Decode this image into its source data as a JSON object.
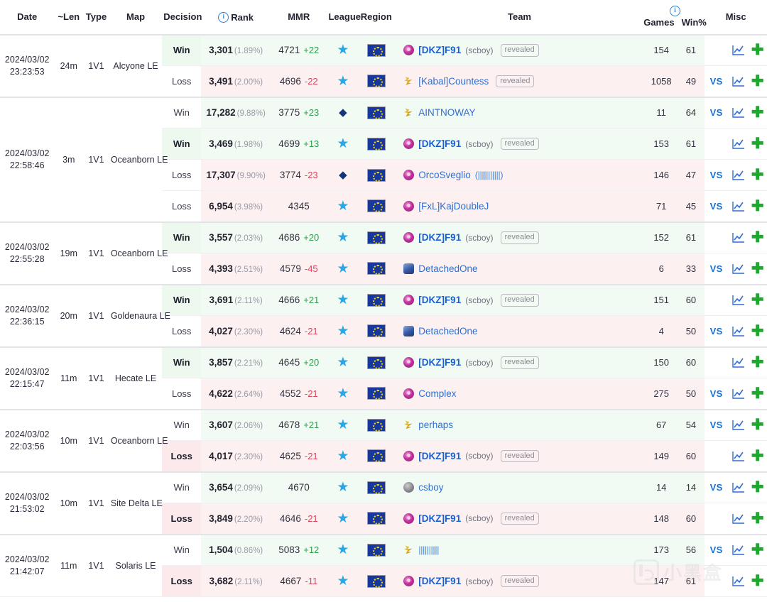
{
  "header": {
    "columns": [
      {
        "label": "Date",
        "name": "date"
      },
      {
        "label": "~Len",
        "name": "len"
      },
      {
        "label": "Type",
        "name": "type"
      },
      {
        "label": "Map",
        "name": "map"
      },
      {
        "label": "Decision",
        "name": "decision"
      },
      {
        "label": "Rank",
        "name": "rank",
        "icon": "info-icon"
      },
      {
        "label": "MMR",
        "name": "mmr"
      },
      {
        "label": "League",
        "name": "league"
      },
      {
        "label": "Region",
        "name": "region"
      },
      {
        "label": "Team",
        "name": "team"
      },
      {
        "label": "Games",
        "name": "games",
        "icon": "info-icon"
      },
      {
        "label": "Win%",
        "name": "winpct"
      },
      {
        "label": "Misc",
        "name": "misc"
      }
    ],
    "rank_label": "Rank",
    "games_label": "Games",
    "winpct_label": "Win%",
    "misc_label": "Misc"
  },
  "colors": {
    "win_tint": "#f2fbf3",
    "loss_tint": "#fdf0f1",
    "win_decision": "#edf8ee",
    "loss_decision": "#fbe9eb",
    "mmr_up": "#2aa04a",
    "mmr_down": "#d9455f",
    "link": "#2f6fd0",
    "plus": "#1fa82f",
    "star": "#29a6e8",
    "diamond": "#12367a"
  },
  "labels": {
    "vs": "VS",
    "revealed": "revealed",
    "chart_icon": "chart-icon",
    "add_icon": "plus-icon"
  },
  "watermark": "小黑盒",
  "groups": [
    {
      "date_line1": "2024/03/02",
      "date_line2": "23:23:53",
      "len": "24m",
      "type": "1V1",
      "map": "Alcyone LE",
      "rows": [
        {
          "decision": "Win",
          "highlight": true,
          "outcome": "win",
          "rank": "3,301",
          "pct": "(1.89%)",
          "mmr": "4721",
          "delta": "+22",
          "delta_dir": "up",
          "league": "star",
          "region": "eu",
          "race": "protoss",
          "name": "[DKZ]F91",
          "alias": "(scboy)",
          "alias_style": "plain",
          "me": true,
          "revealed": true,
          "games": "154",
          "winpct": "61",
          "vs": false
        },
        {
          "decision": "Loss",
          "highlight": false,
          "outcome": "loss",
          "rank": "3,491",
          "pct": "(2.00%)",
          "mmr": "4696",
          "delta": "-22",
          "delta_dir": "down",
          "league": "star",
          "region": "eu",
          "race": "zerg",
          "name": "[Kabal]Countess",
          "alias": "",
          "alias_style": "plain",
          "me": false,
          "revealed": true,
          "games": "1058",
          "winpct": "49",
          "vs": true
        }
      ]
    },
    {
      "date_line1": "2024/03/02",
      "date_line2": "22:58:46",
      "len": "3m",
      "type": "1V1",
      "map": "Oceanborn LE",
      "rows": [
        {
          "decision": "Win",
          "highlight": false,
          "outcome": "win",
          "rank": "17,282",
          "pct": "(9.88%)",
          "mmr": "3775",
          "delta": "+23",
          "delta_dir": "up",
          "league": "diamond",
          "region": "eu",
          "race": "zerg",
          "name": "AINTNOWAY",
          "alias": "",
          "alias_style": "plain",
          "me": false,
          "revealed": false,
          "games": "11",
          "winpct": "64",
          "vs": true
        },
        {
          "decision": "Win",
          "highlight": true,
          "outcome": "win",
          "rank": "3,469",
          "pct": "(1.98%)",
          "mmr": "4699",
          "delta": "+13",
          "delta_dir": "up",
          "league": "star",
          "region": "eu",
          "race": "protoss",
          "name": "[DKZ]F91",
          "alias": "(scboy)",
          "alias_style": "plain",
          "me": true,
          "revealed": true,
          "games": "153",
          "winpct": "61",
          "vs": false
        },
        {
          "decision": "Loss",
          "highlight": false,
          "outcome": "loss",
          "rank": "17,307",
          "pct": "(9.90%)",
          "mmr": "3774",
          "delta": "-23",
          "delta_dir": "down",
          "league": "diamond",
          "region": "eu",
          "race": "protoss",
          "name": "OrcoSveglio",
          "alias": "(|||||||||||)",
          "alias_style": "bars",
          "me": false,
          "revealed": false,
          "games": "146",
          "winpct": "47",
          "vs": true
        },
        {
          "decision": "Loss",
          "highlight": false,
          "outcome": "loss",
          "rank": "6,954",
          "pct": "(3.98%)",
          "mmr": "4345",
          "delta": "",
          "delta_dir": "none",
          "league": "star",
          "region": "eu",
          "race": "protoss",
          "name": "[FxL]KajDoubleJ",
          "alias": "",
          "alias_style": "plain",
          "me": false,
          "revealed": false,
          "games": "71",
          "winpct": "45",
          "vs": true
        }
      ]
    },
    {
      "date_line1": "2024/03/02",
      "date_line2": "22:55:28",
      "len": "19m",
      "type": "1V1",
      "map": "Oceanborn LE",
      "rows": [
        {
          "decision": "Win",
          "highlight": true,
          "outcome": "win",
          "rank": "3,557",
          "pct": "(2.03%)",
          "mmr": "4686",
          "delta": "+20",
          "delta_dir": "up",
          "league": "star",
          "region": "eu",
          "race": "protoss",
          "name": "[DKZ]F91",
          "alias": "(scboy)",
          "alias_style": "plain",
          "me": true,
          "revealed": true,
          "games": "152",
          "winpct": "61",
          "vs": false
        },
        {
          "decision": "Loss",
          "highlight": false,
          "outcome": "loss",
          "rank": "4,393",
          "pct": "(2.51%)",
          "mmr": "4579",
          "delta": "-45",
          "delta_dir": "down",
          "league": "star",
          "region": "eu",
          "race": "terran",
          "name": "DetachedOne",
          "alias": "",
          "alias_style": "plain",
          "me": false,
          "revealed": false,
          "games": "6",
          "winpct": "33",
          "vs": true
        }
      ]
    },
    {
      "date_line1": "2024/03/02",
      "date_line2": "22:36:15",
      "len": "20m",
      "type": "1V1",
      "map": "Goldenaura LE",
      "rows": [
        {
          "decision": "Win",
          "highlight": true,
          "outcome": "win",
          "rank": "3,691",
          "pct": "(2.11%)",
          "mmr": "4666",
          "delta": "+21",
          "delta_dir": "up",
          "league": "star",
          "region": "eu",
          "race": "protoss",
          "name": "[DKZ]F91",
          "alias": "(scboy)",
          "alias_style": "plain",
          "me": true,
          "revealed": true,
          "games": "151",
          "winpct": "60",
          "vs": false
        },
        {
          "decision": "Loss",
          "highlight": false,
          "outcome": "loss",
          "rank": "4,027",
          "pct": "(2.30%)",
          "mmr": "4624",
          "delta": "-21",
          "delta_dir": "down",
          "league": "star",
          "region": "eu",
          "race": "terran",
          "name": "DetachedOne",
          "alias": "",
          "alias_style": "plain",
          "me": false,
          "revealed": false,
          "games": "4",
          "winpct": "50",
          "vs": true
        }
      ]
    },
    {
      "date_line1": "2024/03/02",
      "date_line2": "22:15:47",
      "len": "11m",
      "type": "1V1",
      "map": "Hecate LE",
      "rows": [
        {
          "decision": "Win",
          "highlight": true,
          "outcome": "win",
          "rank": "3,857",
          "pct": "(2.21%)",
          "mmr": "4645",
          "delta": "+20",
          "delta_dir": "up",
          "league": "star",
          "region": "eu",
          "race": "protoss",
          "name": "[DKZ]F91",
          "alias": "(scboy)",
          "alias_style": "plain",
          "me": true,
          "revealed": true,
          "games": "150",
          "winpct": "60",
          "vs": false
        },
        {
          "decision": "Loss",
          "highlight": false,
          "outcome": "loss",
          "rank": "4,622",
          "pct": "(2.64%)",
          "mmr": "4552",
          "delta": "-21",
          "delta_dir": "down",
          "league": "star",
          "region": "eu",
          "race": "protoss",
          "name": "Complex",
          "alias": "",
          "alias_style": "plain",
          "me": false,
          "revealed": false,
          "games": "275",
          "winpct": "50",
          "vs": true
        }
      ]
    },
    {
      "date_line1": "2024/03/02",
      "date_line2": "22:03:56",
      "len": "10m",
      "type": "1V1",
      "map": "Oceanborn LE",
      "rows": [
        {
          "decision": "Win",
          "highlight": false,
          "outcome": "win",
          "rank": "3,607",
          "pct": "(2.06%)",
          "mmr": "4678",
          "delta": "+21",
          "delta_dir": "up",
          "league": "star",
          "region": "eu",
          "race": "zerg",
          "name": "perhaps",
          "alias": "",
          "alias_style": "plain",
          "me": false,
          "revealed": false,
          "games": "67",
          "winpct": "54",
          "vs": true
        },
        {
          "decision": "Loss",
          "highlight": true,
          "outcome": "loss",
          "rank": "4,017",
          "pct": "(2.30%)",
          "mmr": "4625",
          "delta": "-21",
          "delta_dir": "down",
          "league": "star",
          "region": "eu",
          "race": "protoss",
          "name": "[DKZ]F91",
          "alias": "(scboy)",
          "alias_style": "plain",
          "me": true,
          "revealed": true,
          "games": "149",
          "winpct": "60",
          "vs": false
        }
      ]
    },
    {
      "date_line1": "2024/03/02",
      "date_line2": "21:53:02",
      "len": "10m",
      "type": "1V1",
      "map": "Site Delta LE",
      "rows": [
        {
          "decision": "Win",
          "highlight": false,
          "outcome": "win",
          "rank": "3,654",
          "pct": "(2.09%)",
          "mmr": "4670",
          "delta": "",
          "delta_dir": "none",
          "league": "star",
          "region": "eu",
          "race": "random",
          "name": "csboy",
          "alias": "",
          "alias_style": "plain",
          "me": false,
          "revealed": false,
          "games": "14",
          "winpct": "14",
          "vs": true
        },
        {
          "decision": "Loss",
          "highlight": true,
          "outcome": "loss",
          "rank": "3,849",
          "pct": "(2.20%)",
          "mmr": "4646",
          "delta": "-21",
          "delta_dir": "down",
          "league": "star",
          "region": "eu",
          "race": "protoss",
          "name": "[DKZ]F91",
          "alias": "(scboy)",
          "alias_style": "plain",
          "me": true,
          "revealed": true,
          "games": "148",
          "winpct": "60",
          "vs": false
        }
      ]
    },
    {
      "date_line1": "2024/03/02",
      "date_line2": "21:42:07",
      "len": "11m",
      "type": "1V1",
      "map": "Solaris LE",
      "rows": [
        {
          "decision": "Win",
          "highlight": false,
          "outcome": "win",
          "rank": "1,504",
          "pct": "(0.86%)",
          "mmr": "5083",
          "delta": "+12",
          "delta_dir": "up",
          "league": "star",
          "region": "eu",
          "race": "zerg",
          "name": "||||||||||",
          "alias": "",
          "alias_style": "bars-name",
          "me": false,
          "revealed": false,
          "games": "173",
          "winpct": "56",
          "vs": true
        },
        {
          "decision": "Loss",
          "highlight": true,
          "outcome": "loss",
          "rank": "3,682",
          "pct": "(2.11%)",
          "mmr": "4667",
          "delta": "-11",
          "delta_dir": "down",
          "league": "star",
          "region": "eu",
          "race": "protoss",
          "name": "[DKZ]F91",
          "alias": "(scboy)",
          "alias_style": "plain",
          "me": true,
          "revealed": true,
          "games": "147",
          "winpct": "61",
          "vs": false
        }
      ]
    }
  ]
}
